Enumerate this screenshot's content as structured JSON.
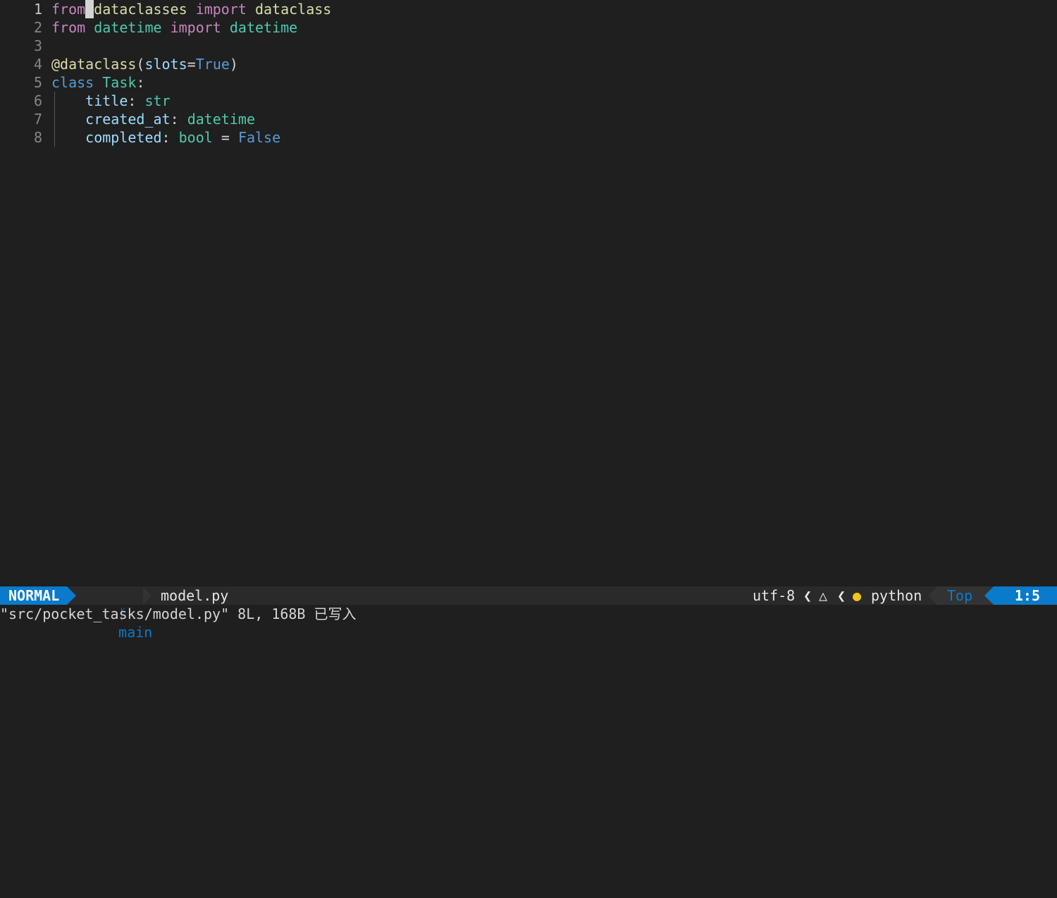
{
  "editor": {
    "lines": [
      {
        "num": "1",
        "segments": [
          [
            "from",
            "kw"
          ],
          [
            " ",
            "cursor"
          ],
          [
            "dataclasses",
            "fn"
          ],
          [
            " ",
            "punc"
          ],
          [
            "import",
            "kw"
          ],
          [
            " ",
            "punc"
          ],
          [
            "dataclass",
            "fn"
          ]
        ]
      },
      {
        "num": "2",
        "segments": [
          [
            "from",
            "kw"
          ],
          [
            " ",
            "punc"
          ],
          [
            "datetime",
            "mod"
          ],
          [
            " ",
            "punc"
          ],
          [
            "import",
            "kw"
          ],
          [
            " ",
            "punc"
          ],
          [
            "datetime",
            "mod"
          ]
        ]
      },
      {
        "num": "3",
        "segments": []
      },
      {
        "num": "4",
        "segments": [
          [
            "@dataclass",
            "fn"
          ],
          [
            "(",
            "punc"
          ],
          [
            "slots",
            "var"
          ],
          [
            "=",
            "punc"
          ],
          [
            "True",
            "const"
          ],
          [
            ")",
            "punc"
          ]
        ]
      },
      {
        "num": "5",
        "segments": [
          [
            "class",
            "const"
          ],
          [
            " ",
            "punc"
          ],
          [
            "Task",
            "mod"
          ],
          [
            ":",
            "punc"
          ]
        ]
      },
      {
        "num": "6",
        "segments": [
          [
            "    ",
            "punc"
          ],
          [
            "title",
            "var"
          ],
          [
            ": ",
            "punc"
          ],
          [
            "str",
            "mod"
          ]
        ]
      },
      {
        "num": "7",
        "segments": [
          [
            "    ",
            "punc"
          ],
          [
            "created_at",
            "var"
          ],
          [
            ": ",
            "punc"
          ],
          [
            "datetime",
            "mod"
          ]
        ]
      },
      {
        "num": "8",
        "segments": [
          [
            "    ",
            "punc"
          ],
          [
            "completed",
            "var"
          ],
          [
            ": ",
            "punc"
          ],
          [
            "bool",
            "mod"
          ],
          [
            " = ",
            "punc"
          ],
          [
            "False",
            "const"
          ]
        ]
      }
    ]
  },
  "statusline": {
    "mode": "NORMAL",
    "branch_icon": "git-branch-icon",
    "branch": "main",
    "filename": "model.py",
    "encoding": "utf-8",
    "os_icon": "linux-icon",
    "filetype_icon": "python-icon",
    "filetype": "python",
    "scroll": "Top",
    "position": "1:5"
  },
  "cmdline": {
    "message": "\"src/pocket_tasks/model.py\" 8L, 168B 已写入"
  },
  "colors": {
    "background": "#1f1f1f",
    "accent": "#0a7aca",
    "keyword": "#c586c0",
    "type": "#4ec9b0",
    "function": "#dcdcaa",
    "variable": "#9cdcfe",
    "constant": "#569cd6"
  }
}
